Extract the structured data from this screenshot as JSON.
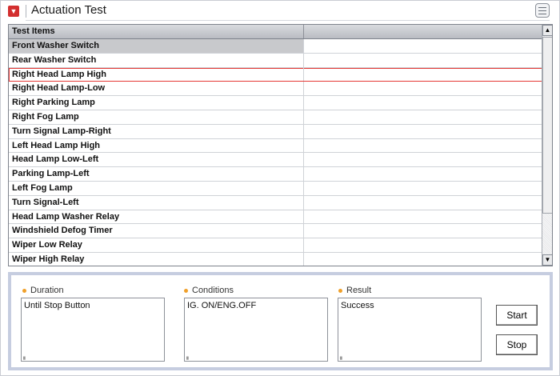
{
  "header": {
    "title": "Actuation Test",
    "app_icon": "chevron-down-icon",
    "menu_icon": "list-menu-icon"
  },
  "table": {
    "columns": [
      "Test Items",
      ""
    ],
    "rows": [
      {
        "name": "Front Washer Switch",
        "value": "",
        "state": "selected"
      },
      {
        "name": "Rear Washer Switch",
        "value": "",
        "state": ""
      },
      {
        "name": "Right Head Lamp High",
        "value": "",
        "state": "highlighted"
      },
      {
        "name": "Right Head Lamp-Low",
        "value": "",
        "state": ""
      },
      {
        "name": "Right Parking Lamp",
        "value": "",
        "state": ""
      },
      {
        "name": "Right Fog Lamp",
        "value": "",
        "state": ""
      },
      {
        "name": "Turn Signal Lamp-Right",
        "value": "",
        "state": ""
      },
      {
        "name": "Left Head Lamp High",
        "value": "",
        "state": ""
      },
      {
        "name": "Head Lamp Low-Left",
        "value": "",
        "state": ""
      },
      {
        "name": "Parking Lamp-Left",
        "value": "",
        "state": ""
      },
      {
        "name": "Left Fog Lamp",
        "value": "",
        "state": ""
      },
      {
        "name": "Turn Signal-Left",
        "value": "",
        "state": ""
      },
      {
        "name": "Head Lamp Washer Relay",
        "value": "",
        "state": ""
      },
      {
        "name": "Windshield Defog Timer",
        "value": "",
        "state": ""
      },
      {
        "name": "Wiper Low Relay",
        "value": "",
        "state": ""
      },
      {
        "name": "Wiper High Relay",
        "value": "",
        "state": ""
      }
    ]
  },
  "scrollbar": {
    "up_icon": "arrow-up-icon",
    "down_icon": "arrow-down-icon"
  },
  "panel": {
    "duration": {
      "label": "Duration",
      "value": "Until Stop Button"
    },
    "conditions": {
      "label": "Conditions",
      "value": "IG. ON/ENG.OFF"
    },
    "result": {
      "label": "Result",
      "value": "Success"
    },
    "start_label": "Start",
    "stop_label": "Stop"
  },
  "colors": {
    "accent_red": "#d32f2f",
    "highlight_border": "#e53935",
    "bullet_orange": "#f0a02a",
    "panel_border": "#c6cde0"
  }
}
